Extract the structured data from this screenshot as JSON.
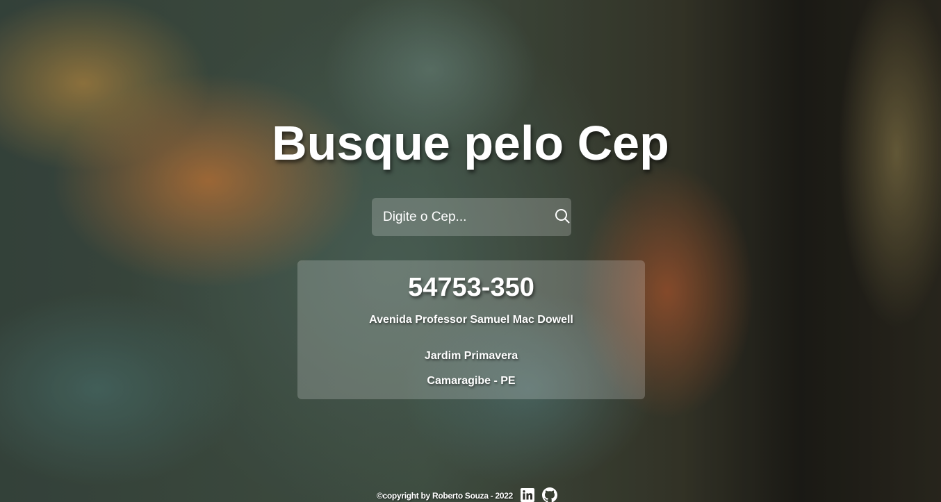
{
  "title": "Busque pelo Cep",
  "search": {
    "placeholder": "Digite o Cep...",
    "value": "",
    "button_icon": "search-icon"
  },
  "result": {
    "cep": "54753-350",
    "street": "Avenida Professor Samuel Mac Dowell",
    "district": "Jardim Primavera",
    "city_state": "Camaragibe - PE"
  },
  "footer": {
    "copyright": "©copyright by Roberto Souza - 2022",
    "links": [
      {
        "icon": "linkedin-icon"
      },
      {
        "icon": "github-icon"
      }
    ]
  },
  "colors": {
    "text": "#ffffff",
    "panel": "rgba(255,255,255,0.2)"
  }
}
